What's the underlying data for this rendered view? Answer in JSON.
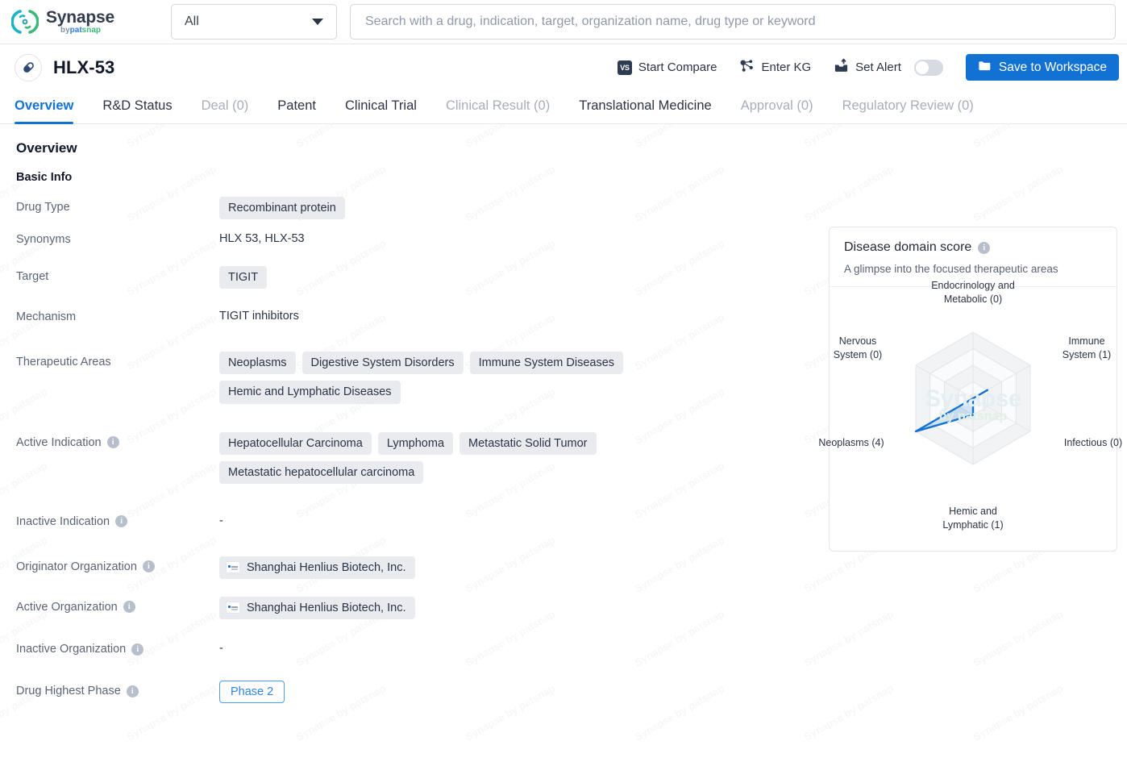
{
  "brand": {
    "name": "Synapse",
    "by": "by",
    "pat": "pat",
    "snap": "snap"
  },
  "search": {
    "scope_value": "All",
    "placeholder": "Search with a drug, indication, target, organization name, drug type or keyword",
    "value": ""
  },
  "drug_header": {
    "name": "HLX-53",
    "actions": {
      "start_compare": "Start Compare",
      "enter_kg": "Enter KG",
      "set_alert": "Set Alert",
      "alert_toggle_state": "off",
      "save_to_workspace": "Save to Workspace"
    }
  },
  "tabs": [
    {
      "label": "Overview",
      "state": "active"
    },
    {
      "label": "R&D Status",
      "state": "normal"
    },
    {
      "label": "Deal (0)",
      "state": "dim"
    },
    {
      "label": "Patent",
      "state": "normal"
    },
    {
      "label": "Clinical Trial",
      "state": "normal"
    },
    {
      "label": "Clinical Result (0)",
      "state": "dim"
    },
    {
      "label": "Translational Medicine",
      "state": "normal"
    },
    {
      "label": "Approval (0)",
      "state": "dim"
    },
    {
      "label": "Regulatory Review (0)",
      "state": "dim"
    }
  ],
  "page": {
    "heading": "Overview",
    "section": "Basic Info",
    "rows": {
      "drug_type": {
        "label": "Drug Type",
        "chips": [
          "Recombinant protein"
        ]
      },
      "synonyms": {
        "label": "Synonyms",
        "text": "HLX 53,  HLX-53"
      },
      "target": {
        "label": "Target",
        "chips": [
          "TIGIT"
        ]
      },
      "mechanism": {
        "label": "Mechanism",
        "text": "TIGIT inhibitors"
      },
      "therapeutic_areas": {
        "label": "Therapeutic Areas",
        "chips": [
          "Neoplasms",
          "Digestive System Disorders",
          "Immune System Diseases",
          "Hemic and Lymphatic Diseases"
        ]
      },
      "active_indication": {
        "label": "Active Indication",
        "chips": [
          "Hepatocellular Carcinoma",
          "Lymphoma",
          "Metastatic Solid Tumor",
          "Metastatic hepatocellular carcinoma"
        ]
      },
      "inactive_indication": {
        "label": "Inactive Indication",
        "text": "-"
      },
      "originator_organization": {
        "label": "Originator Organization",
        "chips": [
          "Shanghai Henlius Biotech, Inc."
        ]
      },
      "active_organization": {
        "label": "Active Organization",
        "chips": [
          "Shanghai Henlius Biotech, Inc."
        ]
      },
      "inactive_organization": {
        "label": "Inactive Organization",
        "text": "-"
      },
      "drug_highest_phase": {
        "label": "Drug Highest Phase",
        "value": "Phase 2"
      }
    }
  },
  "score_card": {
    "title": "Disease domain score",
    "subtitle": "A glimpse into the focused therapeutic areas",
    "watermark_line1": "Synapse",
    "watermark_line2": "by patsnap"
  },
  "chart_data": {
    "type": "radar",
    "title": "Disease domain score",
    "categories": [
      "Endocrinology and\nMetabolic (0)",
      "Immune\nSystem (1)",
      "Infectious (0)",
      "Hemic and\nLymphatic (1)",
      "Neoplasms (4)",
      "Nervous\nSystem (0)"
    ],
    "category_names": [
      "Endocrinology and Metabolic",
      "Immune System",
      "Infectious",
      "Hemic and Lymphatic",
      "Neoplasms",
      "Nervous System"
    ],
    "values": [
      0,
      1,
      0,
      1,
      4,
      0
    ],
    "max": 4,
    "rings": 4,
    "grid": true,
    "legend": "none",
    "series_color": "#1272d4",
    "fill_color": "rgba(18,114,212,0.18)",
    "grid_color": "#e2e4e8"
  },
  "colors": {
    "accent": "#1272d4",
    "chip_bg": "#e9ebef",
    "muted_text": "#5b6476",
    "dim_tab": "#a7aebb"
  }
}
